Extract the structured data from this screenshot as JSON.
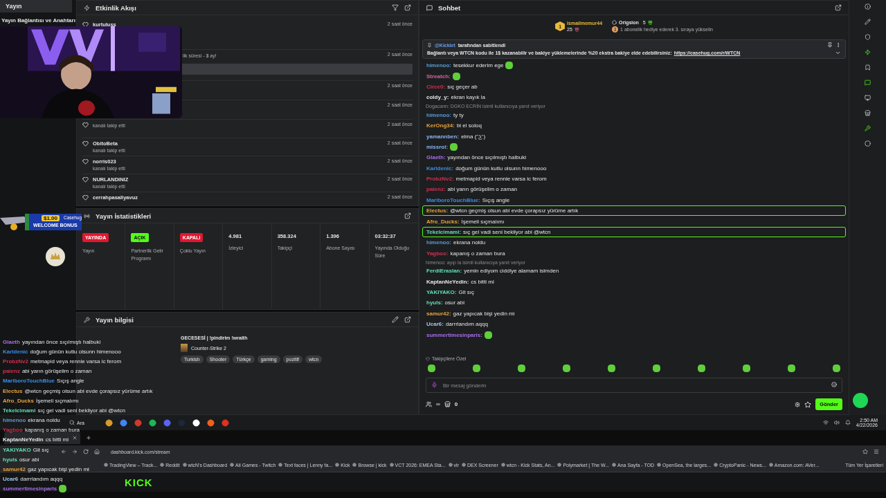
{
  "sidebar": {
    "header": "Yayın",
    "item": "Yayın Bağlantısı ve Anahtarı"
  },
  "overlay": {
    "bonus_amount": "$1.00",
    "bonus_label": "WELCOME BONUS",
    "bonus_brand": "Casehug",
    "chat": [
      {
        "user": "Glaeth",
        "color": "#a86ee8",
        "text": "yayından önce sıçılmıştı halbuki",
        "emote": false
      },
      {
        "user": "Karldenic",
        "color": "#3a8ee6",
        "text": "doğum günün kutlu olsunn himenooo",
        "emote": false
      },
      {
        "user": "ProbzNv2",
        "color": "#d0304f",
        "text": "metmapid veya rennie varsa ic ferom",
        "emote": false
      },
      {
        "user": "paienz",
        "color": "#d0304f",
        "text": "abi yarın görüşelim o zaman",
        "emote": false
      },
      {
        "user": "MarlboroTouchBlue",
        "color": "#3a8ee6",
        "text": "Sıçış angle",
        "emote": false
      },
      {
        "user": "Electus",
        "color": "#e8a23a",
        "text": "@wtcn geçmiş olsun abi evde çorapsız yürüme artık",
        "emote": false
      },
      {
        "user": "Afro_Ducks",
        "color": "#e8a23a",
        "text": "İşemeli sıçmalımı",
        "emote": false
      },
      {
        "user": "Tekelcimami",
        "color": "#5fe0b0",
        "text": "sıç gel vadi seni bekliyor abi @wtcn",
        "emote": false
      },
      {
        "user": "himenoo",
        "color": "#5b9bd5",
        "text": "ekrana noldu",
        "emote": false
      },
      {
        "user": "Yagboo",
        "color": "#d0304f",
        "text": "kapanış o zaman bura",
        "emote": false
      },
      {
        "user": "KaptanNeYedin",
        "color": "#e6e6e6",
        "text": "cs bitti mi",
        "emote": false
      },
      {
        "user": "YAKIYAKO",
        "color": "#5fe0b0",
        "text": "Git sıç",
        "emote": false
      },
      {
        "user": "hyuls",
        "color": "#5fe0b0",
        "text": "osur abi",
        "emote": false
      },
      {
        "user": "samur42",
        "color": "#e8a23a",
        "text": "gaz yapıcak bişi yedin mi",
        "emote": false
      },
      {
        "user": "Ucar6",
        "color": "#a8c8f0",
        "text": "darrrlandım aqqq",
        "emote": false
      },
      {
        "user": "summertimesinparis",
        "color": "#a86ee8",
        "emote": true
      }
    ]
  },
  "feed": {
    "title": "Etkinlik Akışı",
    "rows": [
      {
        "kind": "follow",
        "name": "kurtuluss",
        "time": "2 saat önce"
      },
      {
        "kind": "subscription",
        "sub": "lik süresi - **3** ay!",
        "time": "2 saat önce"
      },
      {
        "kind": "hidden",
        "time": "2 saat önce"
      },
      {
        "kind": "hidden",
        "time": "2 saat önce"
      },
      {
        "kind": "follow",
        "sub": "kanalı takip etti",
        "time": "2 saat önce"
      },
      {
        "kind": "follow",
        "name": "ObitoBeta",
        "sub": "kanalı takip etti",
        "time": "2 saat önce"
      },
      {
        "kind": "follow",
        "name": "norris023",
        "sub": "kanalı takip etti",
        "time": "2 saat önce"
      },
      {
        "kind": "follow",
        "name": "NURLANDINIZ",
        "sub": "kanalı takip etti",
        "time": "2 saat önce"
      },
      {
        "kind": "follow",
        "name": "cerrahpasaliyavuz",
        "time": "2 saat önce"
      }
    ]
  },
  "stats": {
    "title": "Yayın İstatistikleri",
    "items": [
      {
        "kind": "badge",
        "badge": "YAYINDA",
        "color": "#e0182f",
        "label": "Yayın"
      },
      {
        "kind": "badge",
        "badge": "AÇIK",
        "color": "#53fc18",
        "label": "Partnerlik Gelir Programı"
      },
      {
        "kind": "badge",
        "badge": "KAPALI",
        "color": "#e0182f",
        "label": "Çoklu Yayın"
      },
      {
        "kind": "value",
        "value": "4.981",
        "label": "İzleyici"
      },
      {
        "kind": "value",
        "value": "358.324",
        "label": "Takipçi"
      },
      {
        "kind": "value",
        "value": "1.396",
        "label": "Abone Sayısı"
      },
      {
        "kind": "value",
        "value": "03:32:37",
        "label": "Yayında Olduğu Süre"
      }
    ]
  },
  "info": {
    "title": "Yayın bilgisi",
    "stream_title": "GECESESİ | !pindirim !wraith",
    "category": "Counter-Strike 2",
    "tags": [
      "Turkish",
      "Shooter",
      "Türkçe",
      "gaming",
      "pozitif",
      "wtcn"
    ]
  },
  "chat": {
    "title": "Sohbet",
    "leaders": {
      "rank": "1",
      "first": "ismailmemur44",
      "first_count": "25",
      "second": "Origsion",
      "second_count": "5",
      "next_rank": "3",
      "hint": "1 abonelik hediye ederek 3. sıraya yükselin"
    },
    "pinned": {
      "by": "@Kicklet",
      "by_suffix": "tarafından sabitlendi",
      "text": "Bağlantı veya WTCN kodu ile 1$ kazanabilir ve bakiye yüklemelerinde %20 ekstra bakiye elde edebilirsiniz:",
      "link": "https://casehug.com/r/WTCN"
    },
    "messages": [
      {
        "kind": "msg",
        "user": "himenoo:",
        "color": "#5b9bd5",
        "text": "tesekkur ederim ege",
        "emote": true,
        "highlighted": false
      },
      {
        "kind": "msg",
        "user": "Streatch:",
        "color": "#d864a0",
        "emote": true,
        "highlighted": false
      },
      {
        "kind": "msg",
        "user": "Circe0:",
        "color": "#d0304f",
        "text": "sıç geçer ab",
        "emote": false,
        "highlighted": false
      },
      {
        "kind": "msg",
        "user": "coldy_y:",
        "color": "#e6e6e6",
        "text": "ekran kayık la",
        "emote": false,
        "highlighted": false
      },
      {
        "kind": "reply",
        "text": "Dogacann: DGKO ECRİN isimli kullanıcıya yanıt veriyor"
      },
      {
        "kind": "msg",
        "user": "himenoo:",
        "color": "#5b9bd5",
        "text": "ty ty",
        "emote": false,
        "highlighted": false
      },
      {
        "kind": "msg",
        "user": "KerOng34:",
        "color": "#e8a23a",
        "text": "bi el soloq",
        "emote": false,
        "highlighted": false
      },
      {
        "kind": "msg",
        "user": "yamannben:",
        "color": "#8ab4f0",
        "text": "elma (ᵔ͜ʖᵔ)",
        "emote": false,
        "highlighted": false
      },
      {
        "kind": "msg",
        "user": "missrol:",
        "color": "#8ab4f0",
        "emote": true,
        "highlighted": false
      },
      {
        "kind": "msg",
        "user": "Glaeth:",
        "color": "#a86ee8",
        "text": "yayından önce sıçılmıştı halbuki",
        "emote": false,
        "highlighted": false
      },
      {
        "kind": "msg",
        "user": "Karldenic:",
        "color": "#3a8ee6",
        "text": "doğum günün kutlu olsunn himenooo",
        "emote": false,
        "highlighted": false
      },
      {
        "kind": "msg",
        "user": "ProbzNv2:",
        "color": "#d0304f",
        "text": "metmapid veya rennie varsa ic ferom",
        "emote": false,
        "highlighted": false
      },
      {
        "kind": "msg",
        "user": "paienz:",
        "color": "#d0304f",
        "text": "abi yarın görüşelim o zaman",
        "emote": false,
        "highlighted": false
      },
      {
        "kind": "msg",
        "user": "MarlboroTouchBlue:",
        "color": "#3a8ee6",
        "text": "Sıçış angle",
        "emote": false,
        "highlighted": false
      },
      {
        "kind": "msg",
        "user": "Electus:",
        "color": "#e8a23a",
        "text": "@wtcn geçmiş olsun abi evde çorapsız yürüme artık",
        "emote": false,
        "highlighted": true
      },
      {
        "kind": "msg",
        "user": "Afro_Ducks:",
        "color": "#e8a23a",
        "text": "İşemeli sıçmalımı",
        "emote": false,
        "highlighted": false
      },
      {
        "kind": "msg",
        "user": "Tekelcimami:",
        "color": "#5fe0b0",
        "text": "sıç gel vadi seni bekliyor abi @wtcn",
        "emote": false,
        "highlighted": true
      },
      {
        "kind": "msg",
        "user": "himenoo:",
        "color": "#5b9bd5",
        "text": "ekrana noldu",
        "emote": false,
        "highlighted": false
      },
      {
        "kind": "msg",
        "user": "Yagboo:",
        "color": "#d0304f",
        "text": "kapanış o zaman bura",
        "emote": false,
        "highlighted": false
      },
      {
        "kind": "reply",
        "text": "himenoo: ayıp la isimli kullanıcıya yanıt veriyor"
      },
      {
        "kind": "msg",
        "user": "FerdiEraslan:",
        "color": "#5fe0b0",
        "text": "yemin ediyom ciddiye alamam isimden",
        "emote": false,
        "highlighted": false
      },
      {
        "kind": "msg",
        "user": "KaptanNeYedin:",
        "color": "#e6e6e6",
        "text": "cs bitti mi",
        "emote": false,
        "highlighted": false
      },
      {
        "kind": "msg",
        "user": "YAKIYAKO:",
        "color": "#5fe0b0",
        "text": "Git sıç",
        "emote": false,
        "highlighted": false
      },
      {
        "kind": "msg",
        "user": "hyuls:",
        "color": "#5fe0b0",
        "text": "osur abi",
        "emote": false,
        "highlighted": false
      },
      {
        "kind": "msg",
        "user": "samur42:",
        "color": "#e8a23a",
        "text": "gaz yapıcak bişi yedin mi",
        "emote": false,
        "highlighted": false
      },
      {
        "kind": "msg",
        "user": "Ucar6:",
        "color": "#a8c8f0",
        "text": "darrrlandım aqqq",
        "emote": false,
        "highlighted": false
      },
      {
        "kind": "msg",
        "user": "summertimesinparis:",
        "color": "#a86ee8",
        "emote": true,
        "highlighted": false
      }
    ],
    "emote_label": "Takipçilere Özel",
    "input": {
      "placeholder": "Bir mesaj gönderin"
    },
    "points": "∞",
    "store_count": "0",
    "send": "Gönder"
  },
  "taskbar": {
    "search": "Ara",
    "time": "2:50 AM",
    "date": "4/22/2026"
  },
  "browser": {
    "address": "dashboard.kick.com/stream",
    "bookmarks": [
      "TradingView – Track...",
      "Reddit",
      "wtcN's Dashboard",
      "All Games - Twitch",
      "Text faces | Lenny fa...",
      "Kick",
      "Browse | kick",
      "VCT 2026: EMEA Sta...",
      "vlr",
      "DEX Screener",
      "wtcn - Kick Stats, An...",
      "Polymarket | The W...",
      "Ana Sayfa - TOD",
      "OpenSea, the larges...",
      "CryptoPanic - News...",
      "Amazon.com: AVer..."
    ],
    "all_bookmarks": "Tüm Yer İşaretleri",
    "logo": "KICK"
  }
}
